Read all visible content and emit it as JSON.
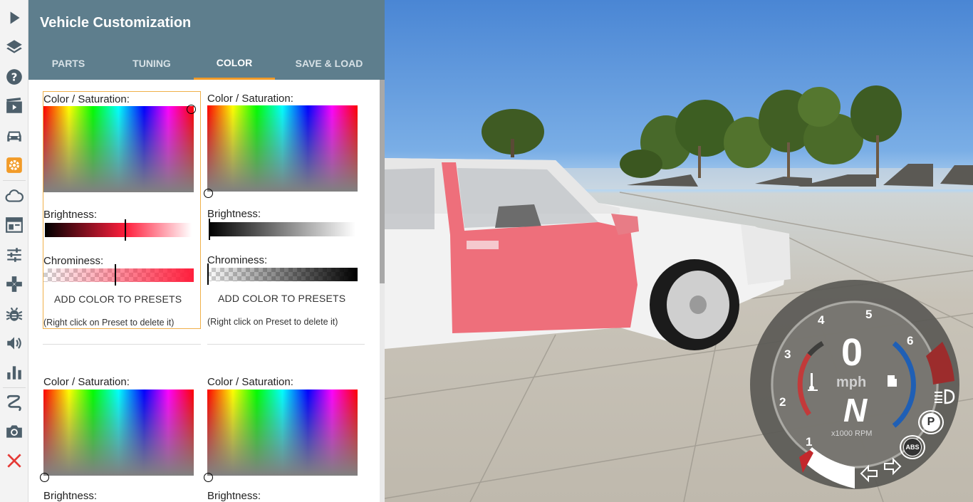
{
  "panel": {
    "title": "Vehicle Customization",
    "tabs": [
      "PARTS",
      "TUNING",
      "COLOR",
      "SAVE & LOAD"
    ],
    "active_tab": "COLOR",
    "accent_color": "#f29b28",
    "header_color": "#5e7e8d"
  },
  "color_blocks": [
    {
      "saturation_label": "Color / Saturation:",
      "brightness_label": "Brightness:",
      "chrominess_label": "Chrominess:",
      "add_button": "ADD COLOR TO PRESETS",
      "hint": "(Right click on Preset to delete it)",
      "base_color": "#ff1e3c",
      "brightness": 0.55,
      "chrominess": 0.48
    },
    {
      "saturation_label": "Color / Saturation:",
      "brightness_label": "Brightness:",
      "chrominess_label": "Chrominess:",
      "add_button": "ADD COLOR TO PRESETS",
      "hint": "(Right click on Preset to delete it)",
      "base_color": "#808080",
      "brightness": 0.0,
      "chrominess": 0.0
    },
    {
      "saturation_label": "Color / Saturation:",
      "brightness_label": "Brightness:"
    },
    {
      "saturation_label": "Color / Saturation:",
      "brightness_label": "Brightness:"
    }
  ],
  "sidebar_icons": [
    "play-icon",
    "layers-icon",
    "help-icon",
    "video-icon",
    "car-icon",
    "settings-gear-icon",
    "cloud-icon",
    "layout-icon",
    "sliders-icon",
    "gamepad-icon",
    "bug-icon",
    "volume-icon",
    "bar-chart-icon",
    "route-icon",
    "camera-icon",
    "close-icon"
  ],
  "hud": {
    "speed": "0",
    "speed_unit": "mph",
    "gear": "N",
    "rpm_label": "x1000 RPM",
    "rpm_ticks": [
      "1",
      "2",
      "3",
      "4",
      "5",
      "6"
    ],
    "parking_label": "P",
    "abs_label": "ABS"
  }
}
